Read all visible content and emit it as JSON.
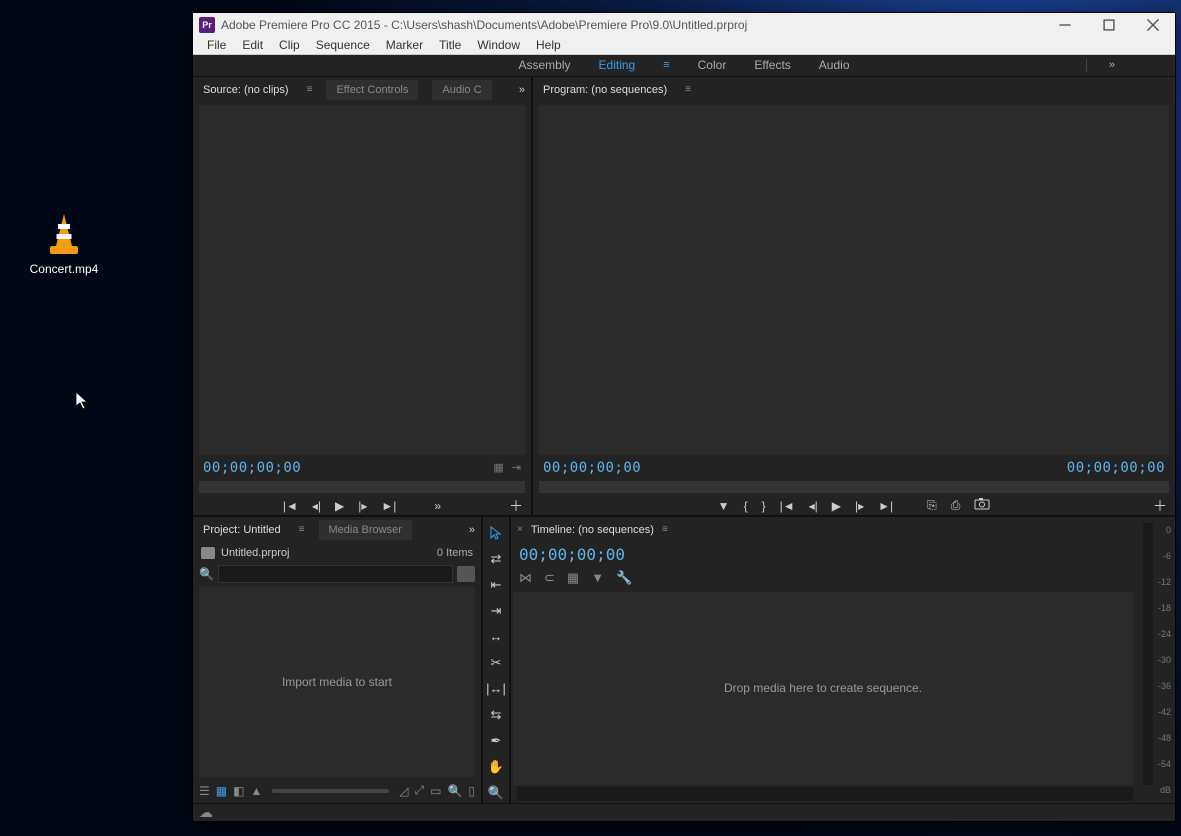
{
  "desktop": {
    "file_icon_label": "Concert.mp4"
  },
  "window": {
    "app_badge": "Pr",
    "title": "Adobe Premiere Pro CC 2015 - C:\\Users\\shash\\Documents\\Adobe\\Premiere Pro\\9.0\\Untitled.prproj"
  },
  "menu": {
    "file": "File",
    "edit": "Edit",
    "clip": "Clip",
    "sequence": "Sequence",
    "marker": "Marker",
    "title": "Title",
    "window": "Window",
    "help": "Help"
  },
  "workspaces": {
    "assembly": "Assembly",
    "editing": "Editing",
    "color": "Color",
    "effects": "Effects",
    "audio": "Audio",
    "overflow": "»"
  },
  "source": {
    "tab_source": "Source: (no clips)",
    "tab_effect_controls": "Effect Controls",
    "tab_audio_clip": "Audio C",
    "overflow": "»",
    "timecode_left": "00;00;00;00"
  },
  "program": {
    "tab": "Program: (no sequences)",
    "timecode_left": "00;00;00;00",
    "timecode_right": "00;00;00;00"
  },
  "project": {
    "tab_project": "Project: Untitled",
    "tab_media_browser": "Media Browser",
    "overflow": "»",
    "file_name": "Untitled.prproj",
    "items_count": "0 Items",
    "search_placeholder": "",
    "body_text": "Import media to start"
  },
  "timeline": {
    "tab": "Timeline: (no sequences)",
    "timecode": "00;00;00;00",
    "body_text": "Drop media here to create sequence."
  },
  "meters": {
    "labels": [
      "0",
      "-6",
      "-12",
      "-18",
      "-24",
      "-30",
      "-36",
      "-42",
      "-48",
      "-54",
      "dB"
    ]
  },
  "colors": {
    "accent": "#3a9ee8",
    "panel_bg": "#232323",
    "monitor_bg": "#2b2b2b"
  }
}
